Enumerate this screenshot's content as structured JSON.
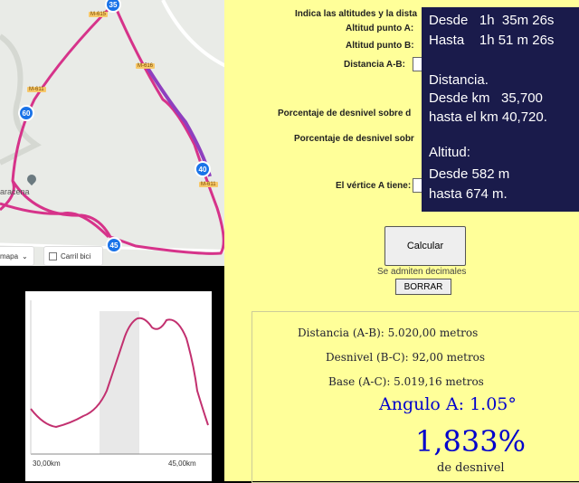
{
  "map": {
    "badges": [
      "35",
      "60",
      "40",
      "45"
    ],
    "road_tags": [
      "M-615",
      "M-611",
      "M-616",
      "M-611"
    ],
    "place": "aracena",
    "map_type_button": "mapa",
    "bike_lane_label": "Carril bici"
  },
  "elevation": {
    "x_ticks": [
      "30,00km",
      "45,00km"
    ]
  },
  "form": {
    "intro": "Indica las altitudes y la dista",
    "altitude_a": "Altitud punto A:",
    "altitude_b": "Altitud punto B:",
    "distance_ab": "Distancia A-B:",
    "pct_over_1": "Porcentaje de desnivel sobre d",
    "pct_over_2": "Porcentaje de desnivel sobr",
    "vertex_a": "El vértice A tiene:",
    "calc_button": "Calcular",
    "decimals_hint": "Se admiten decimales",
    "clear_button": "BORRAR"
  },
  "results": {
    "distance": "Distancia (A-B): 5.020,00 metros",
    "drop": "Desnivel (B-C): 92,00 metros",
    "base": "Base (A-C): 5.019,16 metros",
    "angle": "Angulo A: 1.05°",
    "percent": "1,833%",
    "percent_label": "de desnivel"
  },
  "info": {
    "from_time": "Desde   1h  35m 26s",
    "to_time": "Hasta    1h 51 m 26s",
    "distance_title": "Distancia.",
    "from_km": "Desde km   35,700",
    "to_km": "hasta el km 40,720.",
    "altitude_title": "Altitud:",
    "from_alt": "Desde 582 m",
    "to_alt": "hasta 674 m."
  },
  "colors": {
    "route": "#d6338a",
    "route_highlight": "#8e3fbf",
    "profile": "#c2306f",
    "info_bg": "#1a1b4b",
    "panel_bg": "#ffff99",
    "result_text": "#0000cc"
  }
}
